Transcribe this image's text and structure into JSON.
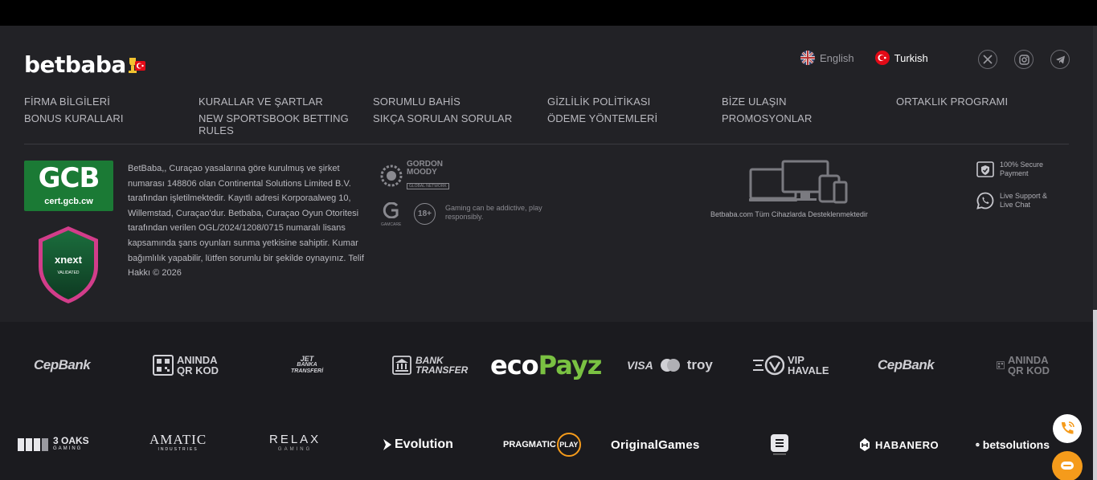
{
  "brand": {
    "logo_text": "betbaba"
  },
  "languages": [
    {
      "label": "English",
      "flag": "uk-flag-icon",
      "active": false
    },
    {
      "label": "Turkish",
      "flag": "tr-flag-icon",
      "active": true
    }
  ],
  "social": [
    "x-twitter-icon",
    "instagram-icon",
    "telegram-icon"
  ],
  "nav": {
    "col1": [
      "FİRMA BİLGİLERİ",
      "BONUS KURALLARI"
    ],
    "col2": [
      "KURALLAR VE ŞARTLAR",
      "NEW SPORTSBOOK BETTING RULES"
    ],
    "col3": [
      "SORUMLU BAHİS",
      "SIKÇA SORULAN SORULAR"
    ],
    "col4": [
      "GİZLİLİK POLİTİKASI",
      "ÖDEME YÖNTEMLERİ"
    ],
    "col5": [
      "BİZE ULAŞIN",
      "PROMOSYONLAR"
    ],
    "col6": [
      "ORTAKLIK PROGRAMI"
    ]
  },
  "certs": {
    "gcb_big": "GCB",
    "gcb_small": "cert.gcb.cw",
    "xnext_label": "xnext",
    "xnext_sub": "VALIDATED"
  },
  "license_text": "BetBaba,, Curaçao yasalarına göre kurulmuş ve şirket numarası 148806 olan Continental Solutions Limited B.V. tarafından işletilmektedir. Kayıtlı adresi Korporaalweg 10, Willemstad, Curaçao'dur. Betbaba, Curaçao Oyun Otoritesi tarafından verilen OGL/2024/1208/0715 numaralı lisans kapsamında şans oyunları sunma yetkisine sahiptir. Kumar bağımlılık yapabilir, lütfen sorumlu bir şekilde oynayınız. Telif Hakkı © 2026",
  "responsible": {
    "gordon_line1": "GORDON",
    "gordon_line2": "MOODY",
    "gordon_sub": "GLOBAL NETWORK",
    "gamcare": "GAMCARE",
    "age": "18+",
    "addictive": "Gaming can be addictive, play responsibly."
  },
  "devices_label": "Betbaba.com Tüm Cihazlarda Desteklenmektedir",
  "features": [
    {
      "icon": "secure-shield-icon",
      "text": "100% Secure Payment"
    },
    {
      "icon": "whatsapp-icon",
      "text": "Live Support & Live Chat"
    }
  ],
  "payments": [
    {
      "name": "cepbank-logo",
      "label": "CepBank"
    },
    {
      "name": "aninda-qr-logo",
      "label1": "ANINDA",
      "label2": "QR KOD"
    },
    {
      "name": "jet-banka-logo",
      "label1": "JET",
      "label2": "BANKA",
      "label3": "TRANSFERİ"
    },
    {
      "name": "bank-transfer-logo",
      "label1": "BANK",
      "label2": "TRANSFER"
    },
    {
      "name": "ecopayz-logo",
      "label1": "eco",
      "label2": "Payz"
    },
    {
      "name": "visa-mc-troy-logo",
      "label1": "VISA",
      "label2": "troy"
    },
    {
      "name": "vip-havale-logo",
      "label1": "VIP",
      "label2": "HAVALE"
    },
    {
      "name": "cepbank-logo-2",
      "label": "CepBank"
    },
    {
      "name": "aninda-qr-logo-2",
      "label1": "ANINDA",
      "label2": "QR KOD"
    }
  ],
  "providers": [
    {
      "name": "3oaks-logo",
      "label1": "3 OAKS",
      "label2": "GAMING"
    },
    {
      "name": "amatic-logo",
      "label1": "AMATIC",
      "label2": "INDUSTRIES"
    },
    {
      "name": "relax-logo",
      "label1": "RELAX",
      "label2": "GAMING"
    },
    {
      "name": "evolution-logo",
      "label": "Evolution"
    },
    {
      "name": "pragmatic-logo",
      "label1": "PRAGMATIC",
      "label2": "PLAY"
    },
    {
      "name": "originalgames-logo",
      "label": "OriginalGames"
    },
    {
      "name": "spribe-logo",
      "label": ""
    },
    {
      "name": "habanero-logo",
      "label": "HABANERO"
    },
    {
      "name": "betsolutions-logo",
      "label": "betsolutions"
    }
  ],
  "colors": {
    "bg_top": "#222226",
    "bg_bottom": "#1b1b1f",
    "accent_green": "#1b7a35",
    "ecopayz_green": "#7ac142",
    "support_orange": "#f59b1b",
    "xnext_pink": "#d23d8a"
  }
}
